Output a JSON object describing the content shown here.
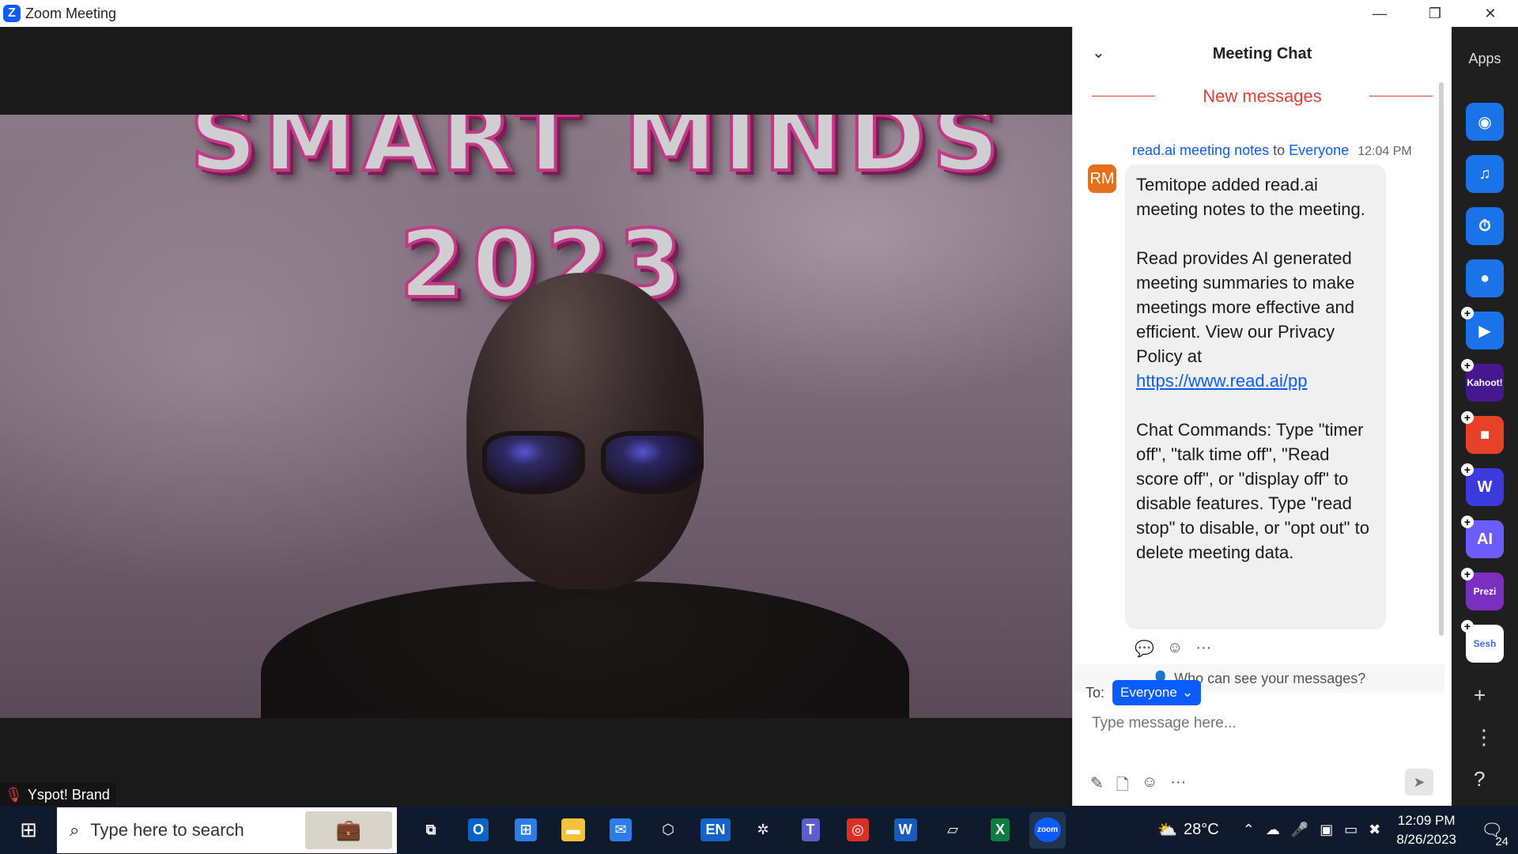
{
  "window": {
    "title": "Zoom Meeting",
    "controls": {
      "minimize": "—",
      "restore": "❐",
      "close": "✕"
    }
  },
  "video": {
    "banner_line1": "SMART MINDS",
    "banner_line2": "2023",
    "participant_name": "Yspot! Brand"
  },
  "chat": {
    "title": "Meeting Chat",
    "collapse_icon": "⌄",
    "new_messages": "New messages",
    "message": {
      "sender": "read.ai meeting notes",
      "to_word": "to",
      "recipient": "Everyone",
      "time": "12:04 PM",
      "avatar": "RM",
      "paragraph1": "Temitope added read.ai meeting notes to the meeting.",
      "paragraph2": "Read provides AI generated meeting summaries to make meetings more effective and efficient. View our Privacy Policy at",
      "link": "https://www.read.ai/pp",
      "paragraph3": "Chat Commands: Type \"timer off\", \"talk time off\", \"Read score off\", or \"display off\" to disable features. Type \"read stop\" to disable, or \"opt out\" to delete meeting data."
    },
    "privacy": "Who can see your messages?",
    "to_label": "To:",
    "to_value": "Everyone",
    "input_placeholder": "Type message here..."
  },
  "apps": {
    "title": "Apps",
    "items": [
      {
        "name": "camera",
        "glyph": "◉",
        "color": "#1a73e8"
      },
      {
        "name": "music",
        "glyph": "♫",
        "color": "#1a73e8"
      },
      {
        "name": "timer",
        "glyph": "⏱",
        "color": "#1a73e8"
      },
      {
        "name": "contact",
        "glyph": "●",
        "color": "#1a73e8"
      },
      {
        "name": "play",
        "glyph": "▶",
        "color": "#1a73e8"
      },
      {
        "name": "kahoot",
        "glyph": "Kahoot!",
        "color": "#46178f"
      },
      {
        "name": "red-app",
        "glyph": "■",
        "color": "#e8412a"
      },
      {
        "name": "w-app",
        "glyph": "W",
        "color": "#3a3adf"
      },
      {
        "name": "ai-app",
        "glyph": "AI",
        "color": "#6b5cff"
      },
      {
        "name": "prezi",
        "glyph": "Prezi",
        "color": "#7b2fbe"
      },
      {
        "name": "sesh",
        "glyph": "Sesh",
        "color": "#ffffff"
      }
    ]
  },
  "taskbar": {
    "search_placeholder": "Type here to search",
    "weather": "28°C",
    "time": "12:09 PM",
    "date": "8/26/2023",
    "notifications": "24",
    "icons": [
      "task-view",
      "outlook",
      "store",
      "file-explorer",
      "mail",
      "3d-app",
      "language-en",
      "app-swirl",
      "teams",
      "chrome",
      "word",
      "notepad",
      "excel",
      "zoom"
    ]
  }
}
